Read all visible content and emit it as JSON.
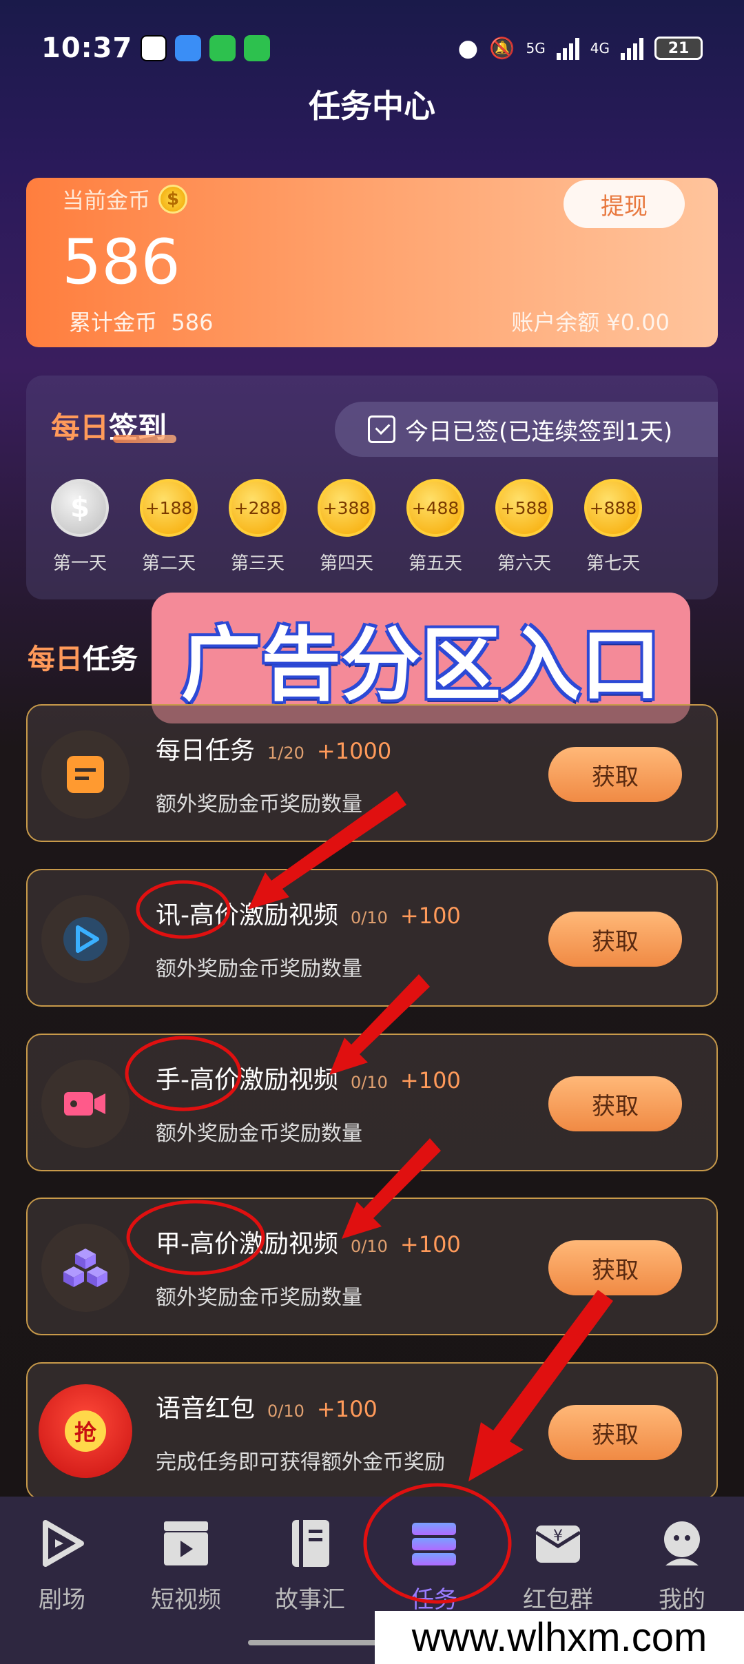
{
  "status_bar": {
    "time": "10:37",
    "net1": "5G",
    "net2": "4G",
    "battery": "21"
  },
  "page_title": "任务中心",
  "coins": {
    "label": "当前金币",
    "current": "586",
    "cumulative_label": "累计金币",
    "cumulative": "586",
    "balance_label": "账户余额",
    "balance": "¥0.00",
    "withdraw": "提现"
  },
  "sign_in": {
    "title_a": "每日",
    "title_b": "签到",
    "status": "今日已签(已连续签到1天)",
    "days": [
      {
        "reward": "$",
        "label": "第一天"
      },
      {
        "reward": "+188",
        "label": "第二天"
      },
      {
        "reward": "+288",
        "label": "第三天"
      },
      {
        "reward": "+388",
        "label": "第四天"
      },
      {
        "reward": "+488",
        "label": "第五天"
      },
      {
        "reward": "+588",
        "label": "第六天"
      },
      {
        "reward": "+888",
        "label": "第七天"
      }
    ]
  },
  "tasks_title": {
    "a": "每日",
    "b": "任务"
  },
  "banner": "广告分区入口",
  "tasks": [
    {
      "name": "每日任务",
      "count": "1/20",
      "reward": "+1000",
      "desc": "额外奖励金币奖励数量",
      "button": "获取"
    },
    {
      "name": "讯-高价激励视频",
      "count": "0/10",
      "reward": "+100",
      "desc": "额外奖励金币奖励数量",
      "button": "获取"
    },
    {
      "name": "手-高价激励视频",
      "count": "0/10",
      "reward": "+100",
      "desc": "额外奖励金币奖励数量",
      "button": "获取"
    },
    {
      "name": "甲-高价激励视频",
      "count": "0/10",
      "reward": "+100",
      "desc": "额外奖励金币奖励数量",
      "button": "获取"
    },
    {
      "name": "语音红包",
      "count": "0/10",
      "reward": "+100",
      "desc": "完成任务即可获得额外金币奖励",
      "button": "获取"
    }
  ],
  "red_packet_char": "抢",
  "nav": [
    {
      "label": "剧场"
    },
    {
      "label": "短视频"
    },
    {
      "label": "故事汇"
    },
    {
      "label": "任务"
    },
    {
      "label": "红包群"
    },
    {
      "label": "我的"
    }
  ],
  "nav_active": "任务",
  "watermark": "www.wlhxm.com",
  "colors": {
    "accent": "#ff9a5a",
    "annotation": "#e01010",
    "active_tab": "#9a7cff"
  }
}
